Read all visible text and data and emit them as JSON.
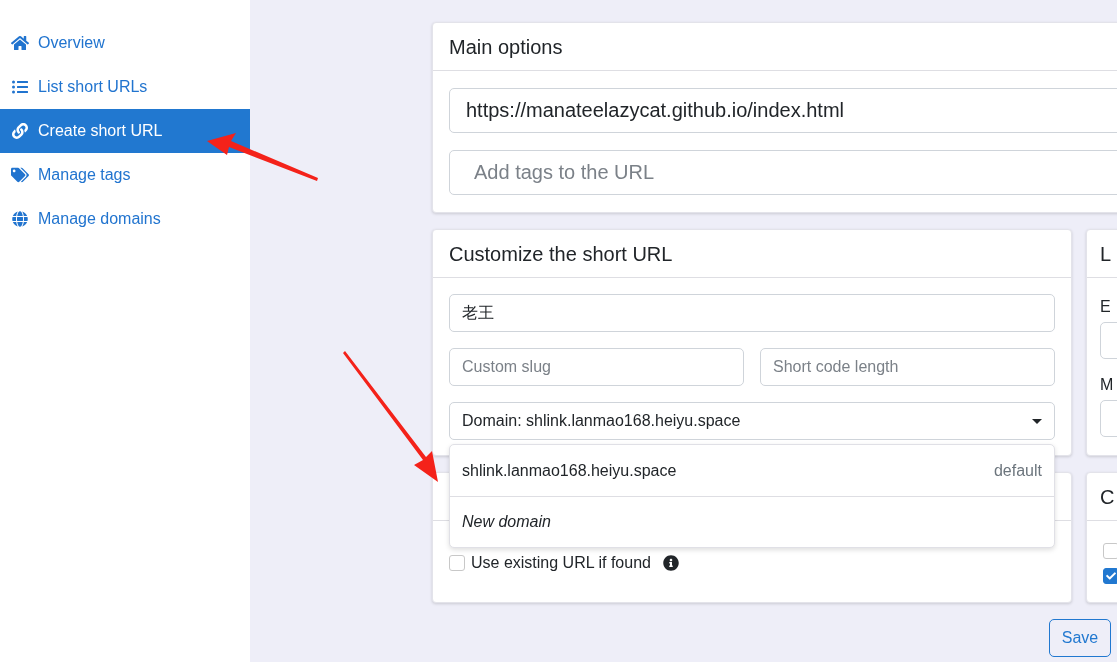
{
  "sidebar": {
    "items": [
      {
        "label": "Overview",
        "selected": false
      },
      {
        "label": "List short URLs",
        "selected": false
      },
      {
        "label": "Create short URL",
        "selected": true
      },
      {
        "label": "Manage tags",
        "selected": false
      },
      {
        "label": "Manage domains",
        "selected": false
      }
    ]
  },
  "main_options": {
    "title": "Main options",
    "url_field": {
      "value": "https://manateelazycat.github.io/index.html"
    },
    "tags_field": {
      "placeholder": "Add tags to the URL"
    }
  },
  "customize": {
    "title": "Customize the short URL",
    "title_field": {
      "value": "老王"
    },
    "slug_field": {
      "placeholder": "Custom slug"
    },
    "length_field": {
      "placeholder": "Short code length"
    },
    "domain_select": {
      "value": "Domain: shlink.lanmao168.heiyu.space",
      "expanded": true,
      "options": [
        {
          "kind": "domain",
          "label": "shlink.lanmao168.heiyu.space",
          "badge": "default"
        },
        {
          "kind": "action",
          "label": "New domain"
        }
      ]
    }
  },
  "extra_checks": {
    "checkbox": {
      "label": "Use existing URL if found",
      "checked": false
    }
  },
  "limits": {
    "title": "L",
    "fields": [
      {
        "label": "E"
      },
      {
        "label": "M"
      }
    ]
  },
  "config": {
    "title": "C",
    "checkboxes": [
      {
        "checked": false
      },
      {
        "checked": true
      }
    ]
  },
  "save_button": {
    "label": "Save"
  }
}
